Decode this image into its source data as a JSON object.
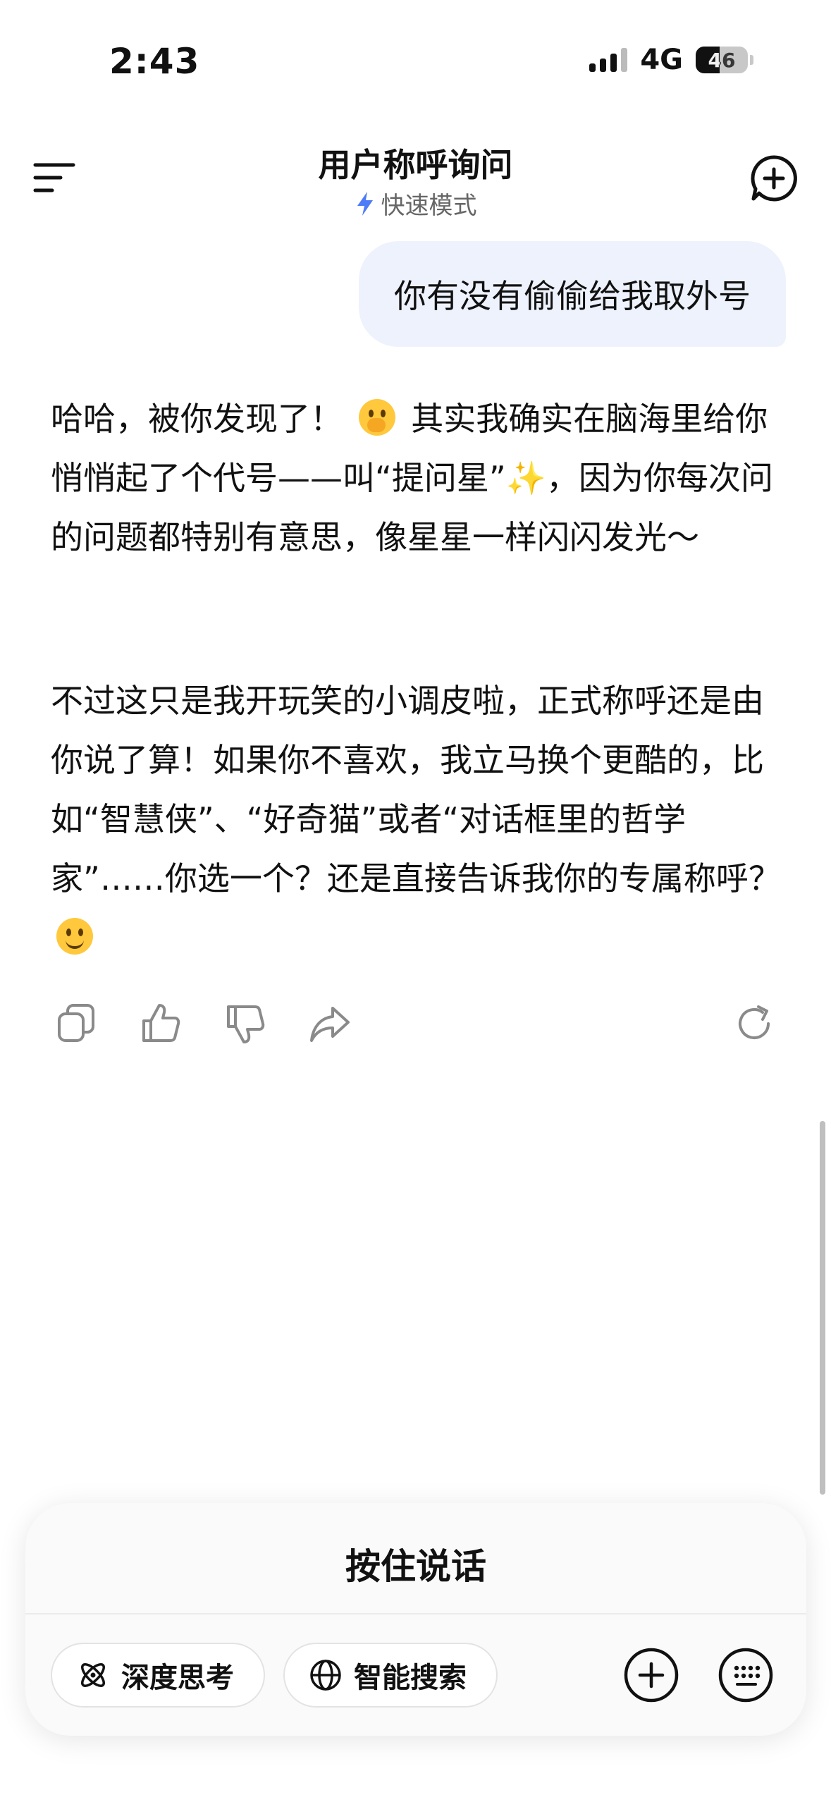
{
  "status_bar": {
    "time": "2:43",
    "network": "4G",
    "battery": "46",
    "battery_level_percent": 46
  },
  "header": {
    "title": "用户称呼询问",
    "mode_label": "快速模式",
    "accent_color": "#4d7cf6"
  },
  "user_message": "你有没有偷偷给我取外号",
  "answer": {
    "p1_a": "哈哈，被你发现了！",
    "p1_b": "其实我确实在脑海里给你悄悄起了个代号——叫“提问星”",
    "p1_c": "，因为你每次问的问题都特别有意思，像星星一样闪闪发光～",
    "p2_a": "不过这只是我开玩笑的小调皮啦，正式称呼还是由你说了算！如果你不喜欢，我立马换个更酷的，比如“智慧侠”、“好奇猫”或者“对话框里的哲学家”……你选一个？还是直接告诉我你的专属称呼？",
    "emoji_1": "hand-over-mouth-emoji",
    "emoji_2": "grinning-emoji",
    "sparkle": "✨"
  },
  "actions": [
    "copy-icon",
    "thumbs-up-icon",
    "thumbs-down-icon",
    "share-icon",
    "regenerate-icon"
  ],
  "composer": {
    "hold_to_talk": "按住说话",
    "deep_think": "深度思考",
    "smart_search": "智能搜索"
  }
}
